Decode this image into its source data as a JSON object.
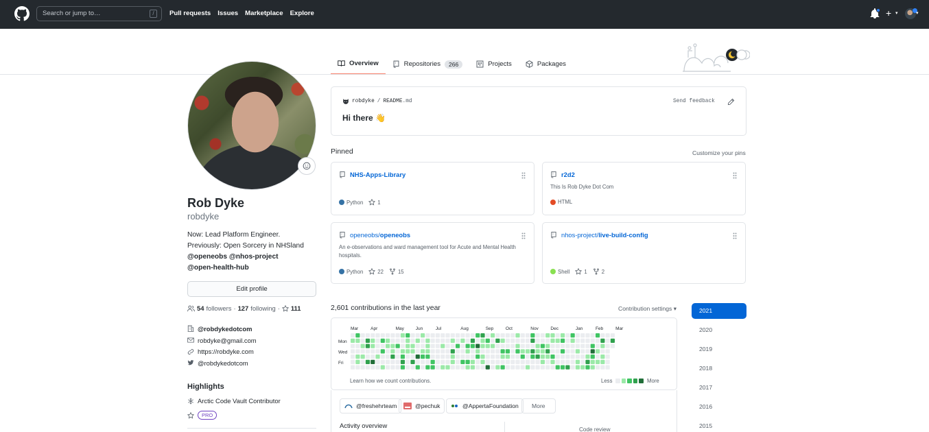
{
  "header": {
    "search_placeholder": "Search or jump to…",
    "slash_key": "/",
    "nav": [
      "Pull requests",
      "Issues",
      "Marketplace",
      "Explore"
    ]
  },
  "tabs": [
    {
      "label": "Overview",
      "icon": "book-icon",
      "active": true
    },
    {
      "label": "Repositories",
      "icon": "repo-icon",
      "count": "266"
    },
    {
      "label": "Projects",
      "icon": "project-icon"
    },
    {
      "label": "Packages",
      "icon": "package-icon"
    }
  ],
  "profile": {
    "name": "Rob Dyke",
    "username": "robdyke",
    "bio_line1": "Now: Lead Platform Engineer.",
    "bio_line2": "Previously: Open Sorcery in NHSland",
    "bio_mentions1": "@openeobs @nhos-project",
    "bio_mentions2": "@open-health-hub",
    "edit_label": "Edit profile",
    "followers_count": "54",
    "followers_label": "followers",
    "following_count": "127",
    "following_label": "following",
    "stars_count": "111",
    "company": "@robdykedotcom",
    "email": "robdyke@gmail.com",
    "website": "https://robdyke.com",
    "twitter": "@robdykedotcom",
    "highlights_title": "Highlights",
    "highlight_1": "Arctic Code Vault Contributor",
    "pro_badge": "PRO"
  },
  "readme": {
    "owner": "robdyke",
    "separator": "/",
    "file": "README",
    "ext": ".md",
    "feedback": "Send feedback",
    "greeting": "Hi there 👋"
  },
  "pinned": {
    "title": "Pinned",
    "customize": "Customize your pins",
    "items": [
      {
        "owner": "",
        "repo": "NHS-Apps-Library",
        "desc": "",
        "lang": "Python",
        "lang_color": "#3572A5",
        "stars": "1",
        "forks": ""
      },
      {
        "owner": "",
        "repo": "r2d2",
        "desc": "This Is Rob Dyke Dot Com",
        "lang": "HTML",
        "lang_color": "#e34c26",
        "stars": "",
        "forks": ""
      },
      {
        "owner": "openeobs/",
        "repo": "openeobs",
        "desc": "An e-observations and ward management tool for Acute and Mental Health hospitals.",
        "lang": "Python",
        "lang_color": "#3572A5",
        "stars": "22",
        "forks": "15"
      },
      {
        "owner": "nhos-project/",
        "repo": "live-build-config",
        "desc": "",
        "lang": "Shell",
        "lang_color": "#89e051",
        "stars": "1",
        "forks": "2"
      }
    ]
  },
  "contributions": {
    "title": "2,601 contributions in the last year",
    "settings": "Contribution settings",
    "months": [
      "Mar",
      "Apr",
      "May",
      "Jun",
      "Jul",
      "Aug",
      "Sep",
      "Oct",
      "Nov",
      "Dec",
      "Jan",
      "Feb",
      "Mar"
    ],
    "days": [
      "Mon",
      "Wed",
      "Fri"
    ],
    "learn": "Learn how we count contributions.",
    "less": "Less",
    "more": "More",
    "colors": [
      "#ebedf0",
      "#9be9a8",
      "#40c463",
      "#30a14e",
      "#216e39"
    ]
  },
  "orgs": [
    {
      "label": "@freshehrteam"
    },
    {
      "label": "@pechuk"
    },
    {
      "label": "@AppertaFoundation"
    }
  ],
  "more_label": "More",
  "activity_title": "Activity overview",
  "code_review": "Code review",
  "years": [
    "2021",
    "2020",
    "2019",
    "2018",
    "2017",
    "2016",
    "2015"
  ]
}
